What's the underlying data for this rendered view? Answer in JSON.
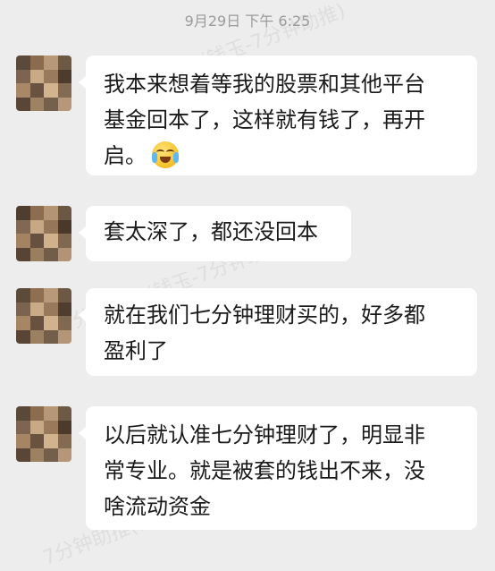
{
  "header": {
    "timestamp": "9月29日 下午 6:25"
  },
  "watermark": {
    "text": "7分钟助推(钱玉-7分钟助推)"
  },
  "messages": [
    {
      "line1": "我本来想着等我的股票和其他平台",
      "line2": "基金回本了，这样就有钱了，再开",
      "line3": "启。",
      "emoji": "face-with-tears-of-joy-icon"
    },
    {
      "line1": "套太深了，都还没回本"
    },
    {
      "line1": "就在我们七分钟理财买的，好多都",
      "line2": "盈利了"
    },
    {
      "line1": "以后就认准七分钟理财了，明显非",
      "line2": "常专业。就是被套的钱出不来，没",
      "line3": "啥流动资金"
    }
  ],
  "colors": {
    "background": "#ededed",
    "bubble": "#ffffff",
    "text": "#1a1a1a",
    "timestamp": "#9b9b9b"
  }
}
